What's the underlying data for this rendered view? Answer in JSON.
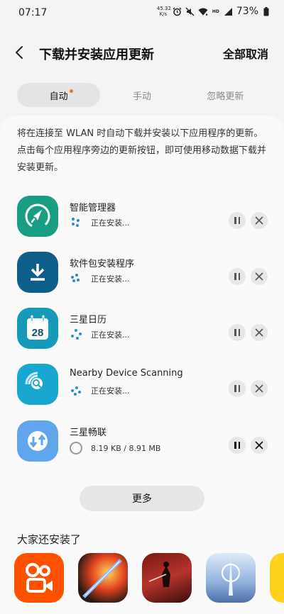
{
  "status_bar": {
    "time": "07:17",
    "net_speed_value": "45.32",
    "net_speed_unit": "K/s",
    "network": "HD",
    "battery_text": "73%"
  },
  "header": {
    "title": "下载并安装应用更新",
    "cancel_all_label": "全部取消"
  },
  "tabs": [
    {
      "label": "自动",
      "active": true,
      "has_dot": true
    },
    {
      "label": "手动",
      "active": false
    },
    {
      "label": "忽略更新",
      "active": false
    }
  ],
  "description": "将在连接至 WLAN 时自动下载并安装以下应用程序的更新。点击每个应用程序旁边的更新按钮，即可使用移动数据下载并安装更新。",
  "apps": [
    {
      "name": "智能管理器",
      "status": "正在安装...",
      "icon": "rocket-icon",
      "color": "#1a9e83"
    },
    {
      "name": "软件包安装程序",
      "status": "正在安装...",
      "icon": "download-icon",
      "color": "#0d5e8a"
    },
    {
      "name": "三星日历",
      "status": "正在安装...",
      "icon": "calendar-icon",
      "color": "#159ab9",
      "calendar_day": "28"
    },
    {
      "name": "Nearby Device Scanning",
      "status": "正在安装...",
      "icon": "radar-search-icon",
      "color": "#19a7d0"
    },
    {
      "name": "三星畅联",
      "status": "8.19 KB / 8.91 MB",
      "icon": "share-arrows-icon",
      "color": "#5fa6ec"
    }
  ],
  "more_label": "更多",
  "also_installed_title": "大家还安装了",
  "recommended": [
    {
      "icon": "kuaishou-logo-icon",
      "color": "#ff5000"
    },
    {
      "icon": "game-sword-icon",
      "color": "#3a1f18"
    },
    {
      "icon": "game-warrior-icon",
      "color": "#8b1e1e"
    },
    {
      "icon": "game-fantasy-icon",
      "color": "#aac4e4"
    },
    {
      "icon": "yellow-app-icon",
      "color": "#ffd21e"
    }
  ]
}
